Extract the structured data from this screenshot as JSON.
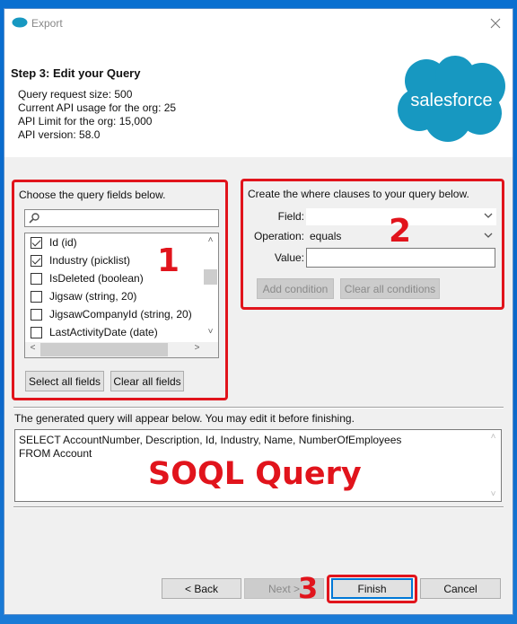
{
  "window": {
    "title": "Export",
    "close_icon": "close-icon"
  },
  "header": {
    "step_title": "Step 3: Edit your Query",
    "info": [
      "Query request size: 500",
      "Current API usage for the org: 25",
      "API Limit for the org: 15,000",
      "API version: 58.0"
    ],
    "logo_text": "salesforce",
    "logo_color": "#1798c1"
  },
  "fields_panel": {
    "label": "Choose the query fields below.",
    "search_value": "",
    "fields": [
      {
        "label": "Id (id)",
        "checked": true
      },
      {
        "label": "Industry (picklist)",
        "checked": true
      },
      {
        "label": "IsDeleted (boolean)",
        "checked": false
      },
      {
        "label": "Jigsaw (string, 20)",
        "checked": false
      },
      {
        "label": "JigsawCompanyId (string, 20)",
        "checked": false
      },
      {
        "label": "LastActivityDate (date)",
        "checked": false
      }
    ],
    "select_all_label": "Select all fields",
    "clear_all_label": "Clear all fields"
  },
  "where_panel": {
    "label": "Create the where clauses to your query below.",
    "field_label": "Field:",
    "field_value": "",
    "operation_label": "Operation:",
    "operation_value": "equals",
    "value_label": "Value:",
    "value_value": "",
    "add_condition_label": "Add condition",
    "clear_conditions_label": "Clear all conditions"
  },
  "query": {
    "label": "The generated query will appear below.  You may edit it before finishing.",
    "text": "SELECT AccountNumber, Description, Id, Industry, Name, NumberOfEmployees\nFROM Account"
  },
  "annotations": {
    "one": "1",
    "two": "2",
    "three": "3",
    "soql": "SOQL Query",
    "color": "#e1141c"
  },
  "footer": {
    "back_label": "< Back",
    "next_label": "Next >",
    "finish_label": "Finish",
    "cancel_label": "Cancel"
  }
}
